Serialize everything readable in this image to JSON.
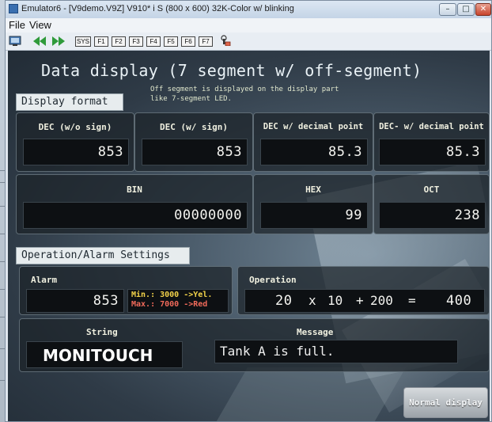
{
  "window": {
    "title": "Emulator6 - [V9demo.V9Z] V910* i S (800 x 600) 32K-Color w/  blinking",
    "min_glyph": "–",
    "max_glyph": "□",
    "close_glyph": "✕"
  },
  "menu": {
    "file": "File",
    "view": "View"
  },
  "toolbar": {
    "sys": "SYS",
    "f1": "F1",
    "f2": "F2",
    "f3": "F3",
    "f4": "F4",
    "f5": "F5",
    "f6": "F6",
    "f7": "F7"
  },
  "screen": {
    "heading": "Data display (7 segment w/ off-segment)",
    "note_line1": "Off segment is displayed on the display part",
    "note_line2": "like 7-segment LED.",
    "display_format_label": "Display format",
    "panels": {
      "dec_nosign": {
        "title": "DEC (w/o sign)",
        "value": "853"
      },
      "dec_sign": {
        "title": "DEC (w/ sign)",
        "value": "853"
      },
      "dec_point": {
        "title": "DEC w/ decimal point",
        "value": "85.3"
      },
      "dec_minus_point": {
        "title": "DEC- w/ decimal point",
        "value": "85.3"
      },
      "bin": {
        "title": "BIN",
        "value": "00000000"
      },
      "hex": {
        "title": "HEX",
        "value": "99"
      },
      "oct": {
        "title": "OCT",
        "value": "238"
      }
    },
    "op_alarm_label": "Operation/Alarm Settings",
    "alarm": {
      "title": "Alarm",
      "value": "853",
      "min_text": "Min.: 3000 ->Yel.",
      "max_text": "Max.: 7000 ->Red",
      "min_color": "#f2d24a",
      "max_color": "#f06a5a"
    },
    "operation": {
      "title": "Operation",
      "operand": "20",
      "op1": "x",
      "factor": "10",
      "op2": "+",
      "addend": "200",
      "eq": "=",
      "result": "400"
    },
    "string": {
      "title": "String",
      "value": "MONITOUCH"
    },
    "message": {
      "title": "Message",
      "value": "Tank A is full."
    },
    "normal_button": "Normal display"
  }
}
